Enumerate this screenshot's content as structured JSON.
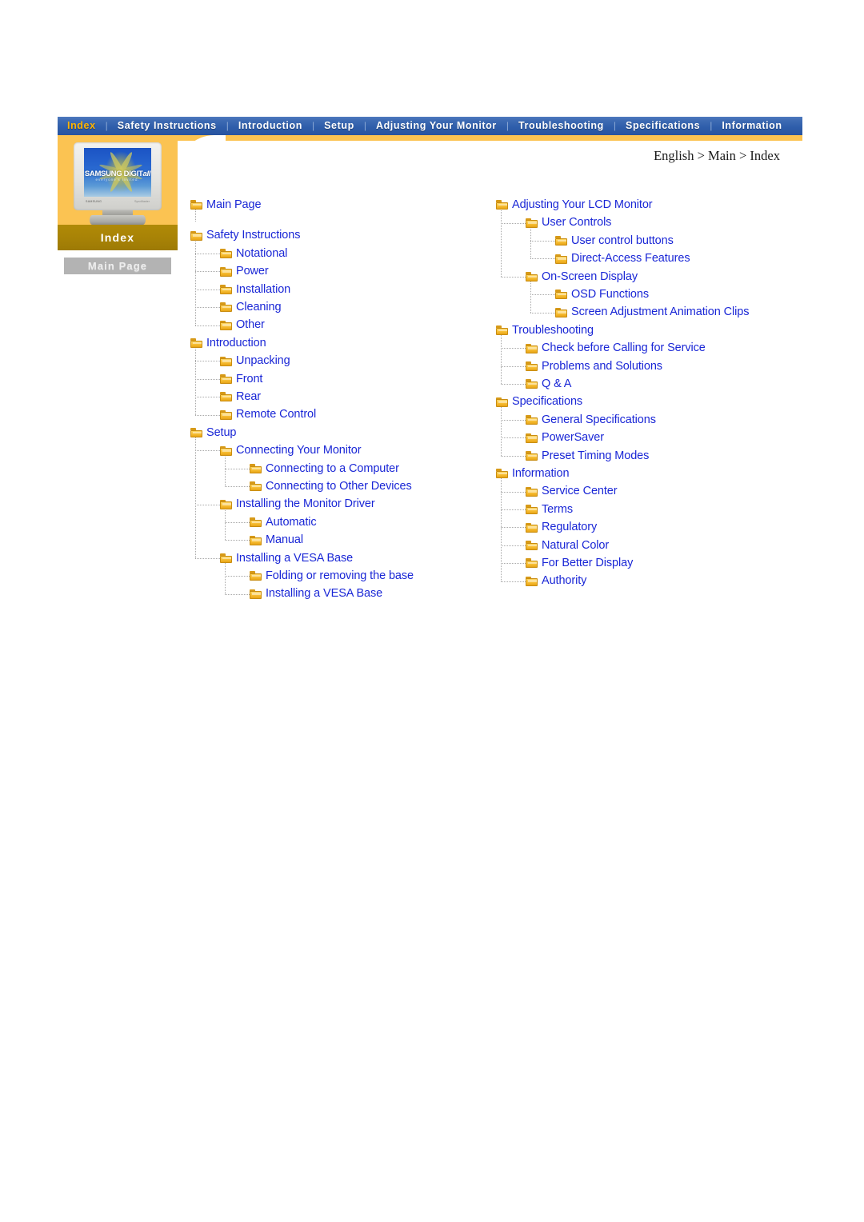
{
  "navbar": {
    "items": [
      {
        "label": "Index",
        "active": true
      },
      {
        "label": "Safety Instructions",
        "active": false
      },
      {
        "label": "Introduction",
        "active": false
      },
      {
        "label": "Setup",
        "active": false
      },
      {
        "label": "Adjusting Your Monitor",
        "active": false
      },
      {
        "label": "Troubleshooting",
        "active": false
      },
      {
        "label": "Specifications",
        "active": false
      },
      {
        "label": "Information",
        "active": false
      }
    ],
    "separator": "|",
    "active_color": "#ffb400",
    "bg_color": "#2f5eab",
    "text_color": "#ffffff"
  },
  "sidebar": {
    "monitor_image": {
      "logo_main": "SAMSUNG DIGIT",
      "logo_italic": "all",
      "tagline": "everyone's invited.",
      "brand_small": "SAMSUNG",
      "model_small": "SyncMaster",
      "icon": "crt-monitor-image"
    },
    "index_band_label": "Index",
    "main_page_button": "Main Page",
    "orange_color": "#fbc352",
    "band_color": "#a88306"
  },
  "breadcrumb": "English > Main > Index",
  "tree": {
    "link_color": "#1a27d6",
    "left": [
      {
        "level": 0,
        "label": "Main Page",
        "gap_after": true
      },
      {
        "level": 0,
        "label": "Safety Instructions"
      },
      {
        "level": 1,
        "label": "Notational"
      },
      {
        "level": 1,
        "label": "Power"
      },
      {
        "level": 1,
        "label": "Installation"
      },
      {
        "level": 1,
        "label": "Cleaning"
      },
      {
        "level": 1,
        "label": "Other"
      },
      {
        "level": 0,
        "label": "Introduction"
      },
      {
        "level": 1,
        "label": "Unpacking"
      },
      {
        "level": 1,
        "label": "Front"
      },
      {
        "level": 1,
        "label": "Rear"
      },
      {
        "level": 1,
        "label": "Remote Control"
      },
      {
        "level": 0,
        "label": "Setup"
      },
      {
        "level": 1,
        "label": "Connecting Your Monitor"
      },
      {
        "level": 2,
        "label": "Connecting to a Computer"
      },
      {
        "level": 2,
        "label": "Connecting to Other Devices"
      },
      {
        "level": 1,
        "label": "Installing the Monitor Driver"
      },
      {
        "level": 2,
        "label": "Automatic"
      },
      {
        "level": 2,
        "label": "Manual"
      },
      {
        "level": 1,
        "label": "Installing a VESA Base"
      },
      {
        "level": 2,
        "label": "Folding or removing the base"
      },
      {
        "level": 2,
        "label": "Installing a VESA Base"
      }
    ],
    "right": [
      {
        "level": 0,
        "label": "Adjusting Your LCD Monitor"
      },
      {
        "level": 1,
        "label": "User Controls"
      },
      {
        "level": 2,
        "label": "User control buttons"
      },
      {
        "level": 2,
        "label": "Direct-Access Features"
      },
      {
        "level": 1,
        "label": "On-Screen Display"
      },
      {
        "level": 2,
        "label": "OSD Functions"
      },
      {
        "level": 2,
        "label": "Screen Adjustment Animation Clips"
      },
      {
        "level": 0,
        "label": "Troubleshooting"
      },
      {
        "level": 1,
        "label": "Check before Calling for Service"
      },
      {
        "level": 1,
        "label": "Problems and Solutions"
      },
      {
        "level": 1,
        "label": "Q & A"
      },
      {
        "level": 0,
        "label": "Specifications"
      },
      {
        "level": 1,
        "label": "General Specifications"
      },
      {
        "level": 1,
        "label": "PowerSaver"
      },
      {
        "level": 1,
        "label": "Preset Timing Modes"
      },
      {
        "level": 0,
        "label": "Information"
      },
      {
        "level": 1,
        "label": "Service Center"
      },
      {
        "level": 1,
        "label": "Terms"
      },
      {
        "level": 1,
        "label": "Regulatory"
      },
      {
        "level": 1,
        "label": "Natural Color"
      },
      {
        "level": 1,
        "label": "For Better Display"
      },
      {
        "level": 1,
        "label": "Authority"
      }
    ]
  }
}
